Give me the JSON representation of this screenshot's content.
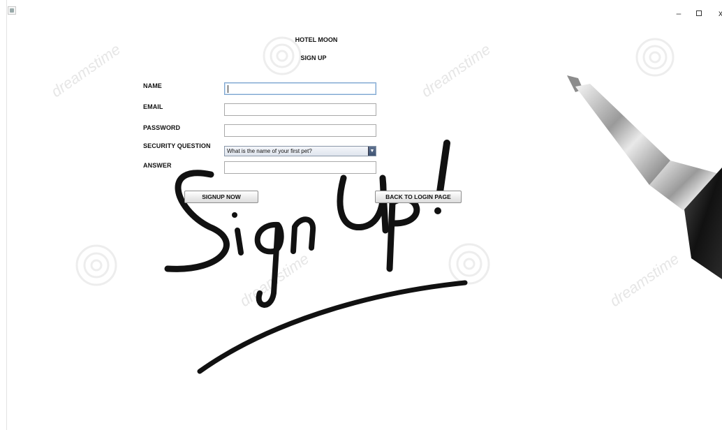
{
  "window": {
    "controls": {
      "minimize": "–",
      "restore": "☐",
      "close": "x"
    }
  },
  "header": {
    "app_name": "HOTEL MOON",
    "subtitle": "SIGN UP"
  },
  "form": {
    "name_label": "NAME",
    "email_label": "EMAIL",
    "password_label": "PASSWORD",
    "security_label": "SECURITY QUESTION",
    "answer_label": "ANSWER",
    "name_value": "",
    "email_value": "",
    "password_value": "",
    "answer_value": "",
    "security_selected": "What is the name of your first pet?"
  },
  "buttons": {
    "signup": "SIGNUP NOW",
    "back": "BACK TO LOGIN PAGE"
  },
  "background": {
    "watermark": "dreamstime"
  }
}
